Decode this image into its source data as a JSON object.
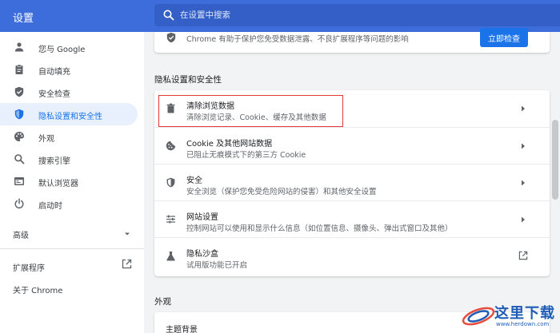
{
  "app": {
    "title": "设置"
  },
  "search": {
    "placeholder": "在设置中搜索",
    "value": ""
  },
  "sidebar": {
    "items": [
      {
        "label": "您与 Google",
        "icon": "person-icon"
      },
      {
        "label": "自动填充",
        "icon": "clipboard-icon"
      },
      {
        "label": "安全检查",
        "icon": "shield-check-icon"
      },
      {
        "label": "隐私设置和安全性",
        "icon": "shield-icon",
        "active": true
      },
      {
        "label": "外观",
        "icon": "palette-icon"
      },
      {
        "label": "搜索引擎",
        "icon": "search-icon"
      },
      {
        "label": "默认浏览器",
        "icon": "browser-icon"
      },
      {
        "label": "启动时",
        "icon": "power-icon"
      }
    ],
    "advanced_label": "高级",
    "extensions_label": "扩展程序",
    "about_label": "关于 Chrome"
  },
  "safety_check": {
    "text": "Chrome 有助于保护您免受数据泄露、不良扩展程序等问题的影响",
    "button_label": "立即检查"
  },
  "privacy": {
    "section_title": "隐私设置和安全性",
    "rows": [
      {
        "title": "清除浏览数据",
        "subtitle": "清除浏览记录、Cookie、缓存及其他数据",
        "icon": "trash-icon"
      },
      {
        "title": "Cookie 及其他网站数据",
        "subtitle": "已阻止无痕模式下的第三方 Cookie",
        "icon": "cookie-icon"
      },
      {
        "title": "安全",
        "subtitle": "安全浏览（保护您免受危险网站的侵害）和其他安全设置",
        "icon": "security-shield-icon"
      },
      {
        "title": "网站设置",
        "subtitle": "控制网站可以使用和显示什么信息（如位置信息、摄像头、弹出式窗口及其他）",
        "icon": "sliders-icon"
      },
      {
        "title": "隐私沙盒",
        "subtitle": "试用版功能已开启",
        "icon": "flask-icon"
      }
    ]
  },
  "appearance": {
    "section_title": "外观",
    "first_item": "主题背景"
  },
  "watermark": {
    "text": "这里下载",
    "url": "www.herdown.com"
  },
  "colors": {
    "topbar": "#3c6ddb",
    "accent": "#1a73e8",
    "highlight": "#e53935"
  }
}
